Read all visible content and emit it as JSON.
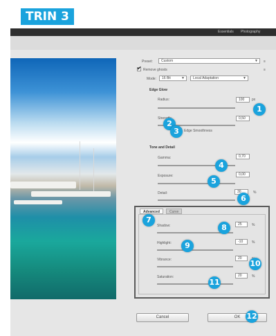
{
  "header_badge": "TRIN 3",
  "top_tabs": [
    "Essentials",
    "Photography"
  ],
  "preset": {
    "label": "Preset:",
    "value": "Custom"
  },
  "remove_ghosts_label": "Remove ghosts",
  "mode": {
    "label": "Mode:",
    "bit_depth": "16 Bit",
    "method": "Local Adaptation"
  },
  "edge_glow": {
    "title": "Edge Glow",
    "radius_label": "Radius:",
    "radius_value": "100",
    "radius_unit": "px",
    "strength_label": "Strength:",
    "strength_value": "0,50",
    "smooth_edges_label": "Edge Smoothness"
  },
  "tone_detail": {
    "title": "Tone and Detail",
    "gamma_label": "Gamma:",
    "gamma_value": "0,70",
    "exposure_label": "Exposure:",
    "exposure_value": "0,00",
    "detail_label": "Detail:",
    "detail_value": "30",
    "detail_unit": "%"
  },
  "advanced": {
    "tab_advanced": "Advanced",
    "tab_curve": "Curve",
    "shadow_label": "Shadow:",
    "shadow_value": "25",
    "shadow_unit": "%",
    "highlight_label": "Highlight:",
    "highlight_value": "-10",
    "highlight_unit": "%",
    "vibrance_label": "Vibrance:",
    "vibrance_value": "20",
    "vibrance_unit": "%",
    "saturation_label": "Saturation:",
    "saturation_value": "20",
    "saturation_unit": "%"
  },
  "cancel_label": "Cancel",
  "ok_label": "OK",
  "markers": [
    "1",
    "2",
    "3",
    "4",
    "5",
    "6",
    "7",
    "8",
    "9",
    "10",
    "11",
    "12"
  ],
  "colors": {
    "accent": "#1aa3dd",
    "dialog_bg": "#e6e6e6",
    "top_bar": "#2e2e2e"
  }
}
